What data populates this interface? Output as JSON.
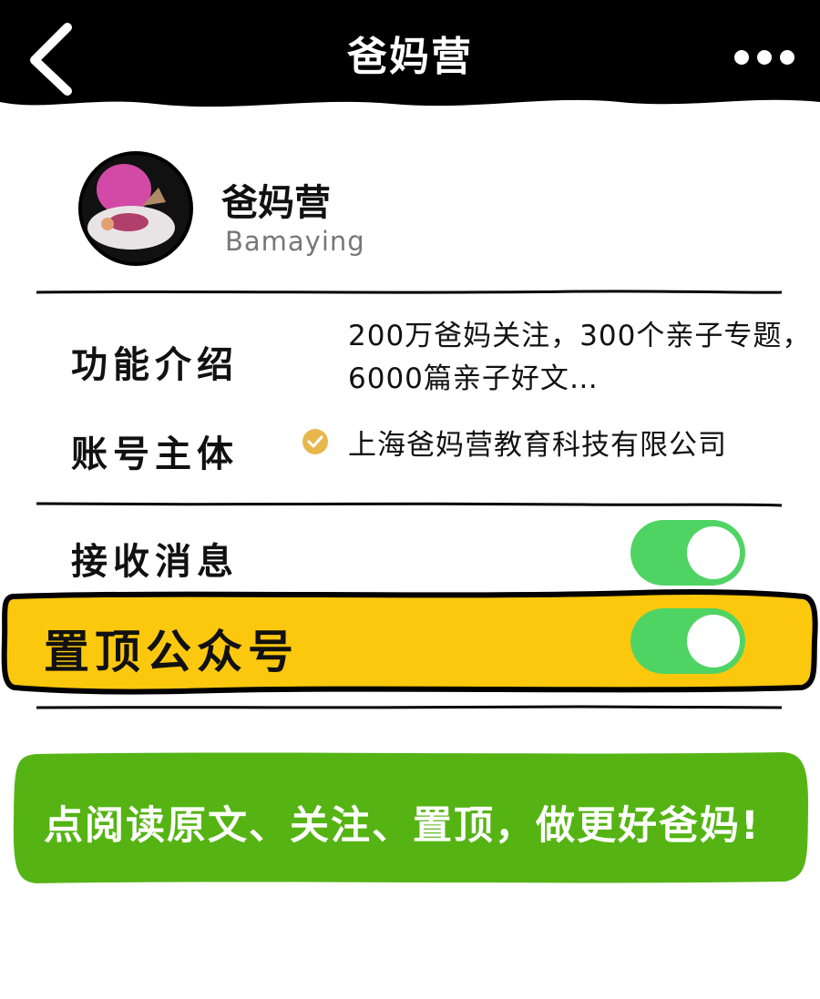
{
  "header": {
    "title": "爸妈营",
    "back_icon": "chevron-left-icon",
    "more_icon": "ellipsis-icon"
  },
  "profile": {
    "name": "爸妈营",
    "account_id": "Bamaying"
  },
  "info": {
    "function_label": "功能介绍",
    "function_line1": "200万爸妈关注，300个亲子专题，",
    "function_line2": "6000篇亲子好文…",
    "entity_label": "账号主体",
    "entity_value": "上海爸妈营教育科技有限公司",
    "verified_icon": "verified-check-icon"
  },
  "settings": {
    "receive_label": "接收消息",
    "receive_on": true,
    "pin_label": "置顶公众号",
    "pin_on": true
  },
  "banner": {
    "text": "点阅读原文、关注、置顶，做更好爸妈!"
  },
  "colors": {
    "topbar": "#000000",
    "toggle_on": "#4fd464",
    "highlight": "#fcc80d",
    "banner": "#55b414",
    "verified": "#e8b74c"
  }
}
